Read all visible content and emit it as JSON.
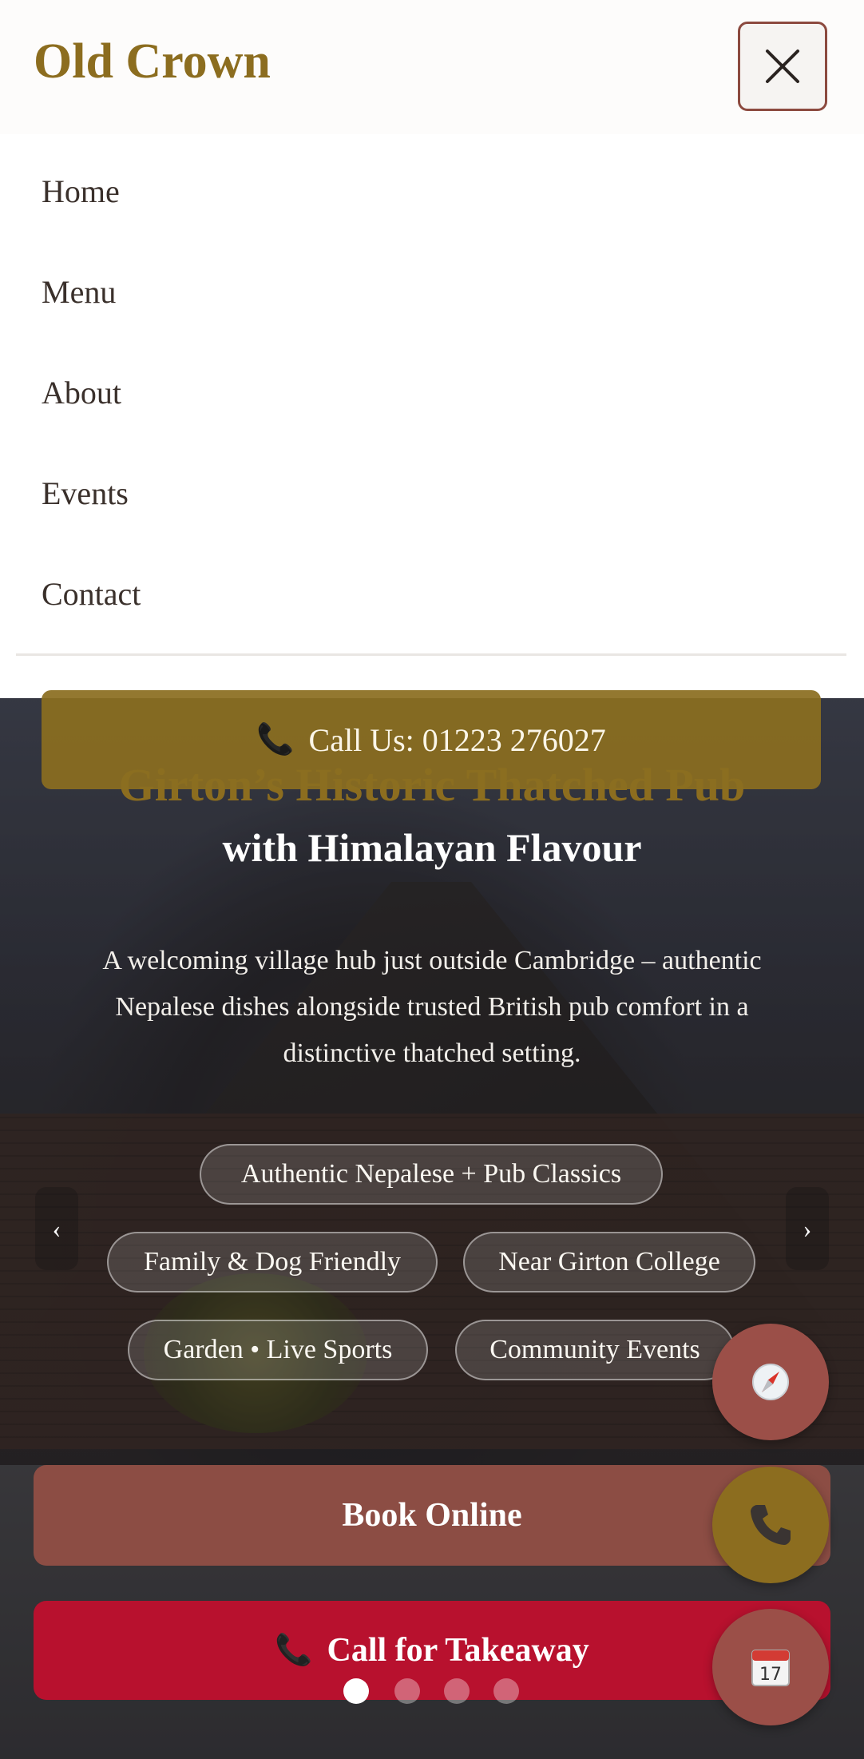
{
  "brand": {
    "name": "Old Crown"
  },
  "nav": {
    "items": [
      {
        "label": "Home"
      },
      {
        "label": "Menu"
      },
      {
        "label": "About"
      },
      {
        "label": "Events"
      },
      {
        "label": "Contact"
      }
    ]
  },
  "call_bar": {
    "icon": "phone-icon",
    "label": "Call Us: 01223 276027"
  },
  "hero": {
    "title_line1": "Girton’s Historic Thatched Pub",
    "title_line2": "with Himalayan Flavour",
    "description": "A welcoming village hub just outside Cambridge – authentic Nepalese dishes alongside trusted British pub comfort in a distinctive thatched setting.",
    "chips": [
      "Authentic Nepalese + Pub Classics",
      "Family & Dog Friendly",
      "Near Girton College",
      "Garden • Live Sports",
      "Community Events"
    ],
    "slides_total": 4,
    "active_slide": 1
  },
  "cta": {
    "book_label": "Book Online",
    "takeaway_label": "Call for Takeaway",
    "takeaway_icon": "phone-icon"
  },
  "fabs": [
    {
      "icon": "compass-icon",
      "color": "#9b4f48"
    },
    {
      "icon": "phone-icon",
      "color": "#8c6d1f"
    },
    {
      "icon": "calendar-icon",
      "color": "#9b4f48"
    }
  ],
  "colors": {
    "brand_gold": "#8c6d1f",
    "brand_red": "#8c4d44",
    "takeaway_red": "#b8112e",
    "nav_text": "#3a302b"
  }
}
